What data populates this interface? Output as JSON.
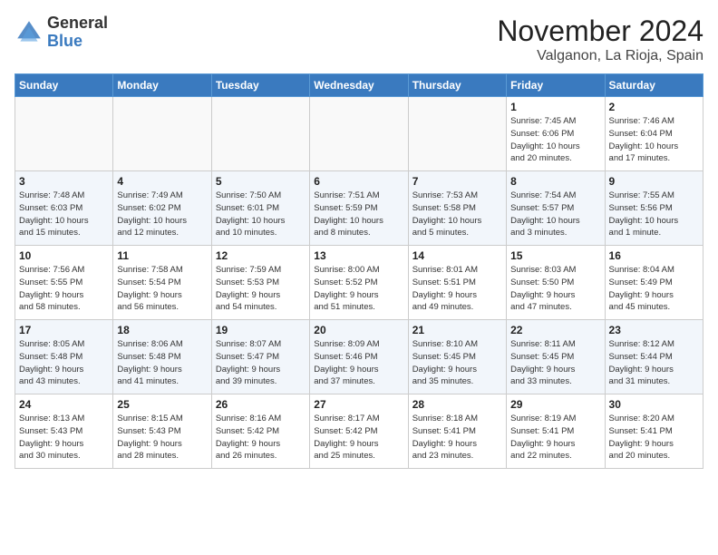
{
  "header": {
    "logo_general": "General",
    "logo_blue": "Blue",
    "month_title": "November 2024",
    "location": "Valganon, La Rioja, Spain"
  },
  "weekdays": [
    "Sunday",
    "Monday",
    "Tuesday",
    "Wednesday",
    "Thursday",
    "Friday",
    "Saturday"
  ],
  "weeks": [
    [
      {
        "day": "",
        "info": ""
      },
      {
        "day": "",
        "info": ""
      },
      {
        "day": "",
        "info": ""
      },
      {
        "day": "",
        "info": ""
      },
      {
        "day": "",
        "info": ""
      },
      {
        "day": "1",
        "info": "Sunrise: 7:45 AM\nSunset: 6:06 PM\nDaylight: 10 hours\nand 20 minutes."
      },
      {
        "day": "2",
        "info": "Sunrise: 7:46 AM\nSunset: 6:04 PM\nDaylight: 10 hours\nand 17 minutes."
      }
    ],
    [
      {
        "day": "3",
        "info": "Sunrise: 7:48 AM\nSunset: 6:03 PM\nDaylight: 10 hours\nand 15 minutes."
      },
      {
        "day": "4",
        "info": "Sunrise: 7:49 AM\nSunset: 6:02 PM\nDaylight: 10 hours\nand 12 minutes."
      },
      {
        "day": "5",
        "info": "Sunrise: 7:50 AM\nSunset: 6:01 PM\nDaylight: 10 hours\nand 10 minutes."
      },
      {
        "day": "6",
        "info": "Sunrise: 7:51 AM\nSunset: 5:59 PM\nDaylight: 10 hours\nand 8 minutes."
      },
      {
        "day": "7",
        "info": "Sunrise: 7:53 AM\nSunset: 5:58 PM\nDaylight: 10 hours\nand 5 minutes."
      },
      {
        "day": "8",
        "info": "Sunrise: 7:54 AM\nSunset: 5:57 PM\nDaylight: 10 hours\nand 3 minutes."
      },
      {
        "day": "9",
        "info": "Sunrise: 7:55 AM\nSunset: 5:56 PM\nDaylight: 10 hours\nand 1 minute."
      }
    ],
    [
      {
        "day": "10",
        "info": "Sunrise: 7:56 AM\nSunset: 5:55 PM\nDaylight: 9 hours\nand 58 minutes."
      },
      {
        "day": "11",
        "info": "Sunrise: 7:58 AM\nSunset: 5:54 PM\nDaylight: 9 hours\nand 56 minutes."
      },
      {
        "day": "12",
        "info": "Sunrise: 7:59 AM\nSunset: 5:53 PM\nDaylight: 9 hours\nand 54 minutes."
      },
      {
        "day": "13",
        "info": "Sunrise: 8:00 AM\nSunset: 5:52 PM\nDaylight: 9 hours\nand 51 minutes."
      },
      {
        "day": "14",
        "info": "Sunrise: 8:01 AM\nSunset: 5:51 PM\nDaylight: 9 hours\nand 49 minutes."
      },
      {
        "day": "15",
        "info": "Sunrise: 8:03 AM\nSunset: 5:50 PM\nDaylight: 9 hours\nand 47 minutes."
      },
      {
        "day": "16",
        "info": "Sunrise: 8:04 AM\nSunset: 5:49 PM\nDaylight: 9 hours\nand 45 minutes."
      }
    ],
    [
      {
        "day": "17",
        "info": "Sunrise: 8:05 AM\nSunset: 5:48 PM\nDaylight: 9 hours\nand 43 minutes."
      },
      {
        "day": "18",
        "info": "Sunrise: 8:06 AM\nSunset: 5:48 PM\nDaylight: 9 hours\nand 41 minutes."
      },
      {
        "day": "19",
        "info": "Sunrise: 8:07 AM\nSunset: 5:47 PM\nDaylight: 9 hours\nand 39 minutes."
      },
      {
        "day": "20",
        "info": "Sunrise: 8:09 AM\nSunset: 5:46 PM\nDaylight: 9 hours\nand 37 minutes."
      },
      {
        "day": "21",
        "info": "Sunrise: 8:10 AM\nSunset: 5:45 PM\nDaylight: 9 hours\nand 35 minutes."
      },
      {
        "day": "22",
        "info": "Sunrise: 8:11 AM\nSunset: 5:45 PM\nDaylight: 9 hours\nand 33 minutes."
      },
      {
        "day": "23",
        "info": "Sunrise: 8:12 AM\nSunset: 5:44 PM\nDaylight: 9 hours\nand 31 minutes."
      }
    ],
    [
      {
        "day": "24",
        "info": "Sunrise: 8:13 AM\nSunset: 5:43 PM\nDaylight: 9 hours\nand 30 minutes."
      },
      {
        "day": "25",
        "info": "Sunrise: 8:15 AM\nSunset: 5:43 PM\nDaylight: 9 hours\nand 28 minutes."
      },
      {
        "day": "26",
        "info": "Sunrise: 8:16 AM\nSunset: 5:42 PM\nDaylight: 9 hours\nand 26 minutes."
      },
      {
        "day": "27",
        "info": "Sunrise: 8:17 AM\nSunset: 5:42 PM\nDaylight: 9 hours\nand 25 minutes."
      },
      {
        "day": "28",
        "info": "Sunrise: 8:18 AM\nSunset: 5:41 PM\nDaylight: 9 hours\nand 23 minutes."
      },
      {
        "day": "29",
        "info": "Sunrise: 8:19 AM\nSunset: 5:41 PM\nDaylight: 9 hours\nand 22 minutes."
      },
      {
        "day": "30",
        "info": "Sunrise: 8:20 AM\nSunset: 5:41 PM\nDaylight: 9 hours\nand 20 minutes."
      }
    ]
  ]
}
